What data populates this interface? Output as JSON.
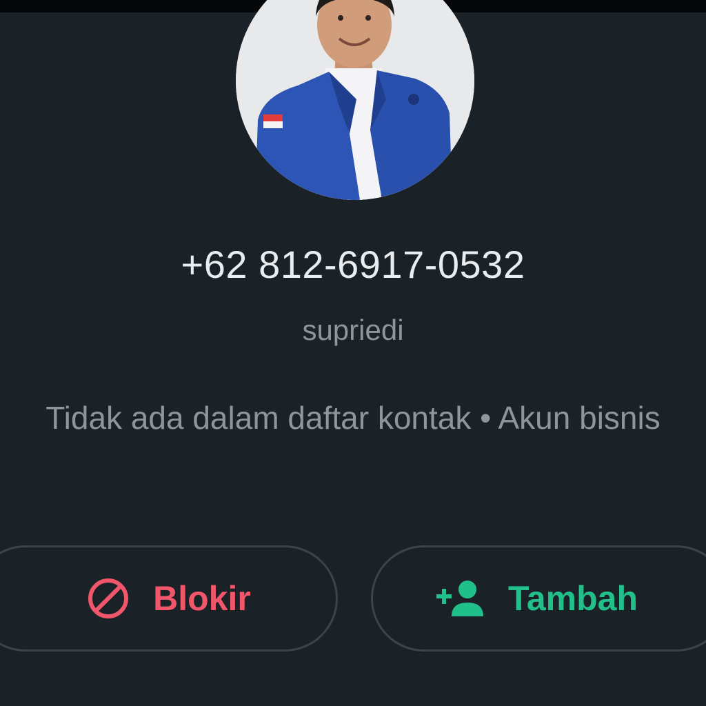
{
  "contact": {
    "phone": "+62 812-6917-0532",
    "username": "supriedi",
    "status": "Tidak ada dalam daftar kontak • Akun bisnis"
  },
  "actions": {
    "block": {
      "label": "Blokir",
      "icon": "block-icon",
      "color": "#f1566a"
    },
    "add": {
      "label": "Tambah",
      "icon": "add-contact-icon",
      "color": "#21c08b"
    }
  },
  "theme": {
    "background": "#1b2227",
    "primary_text": "#e9edef",
    "secondary_text": "#8d969b",
    "button_border": "#3b4449"
  }
}
